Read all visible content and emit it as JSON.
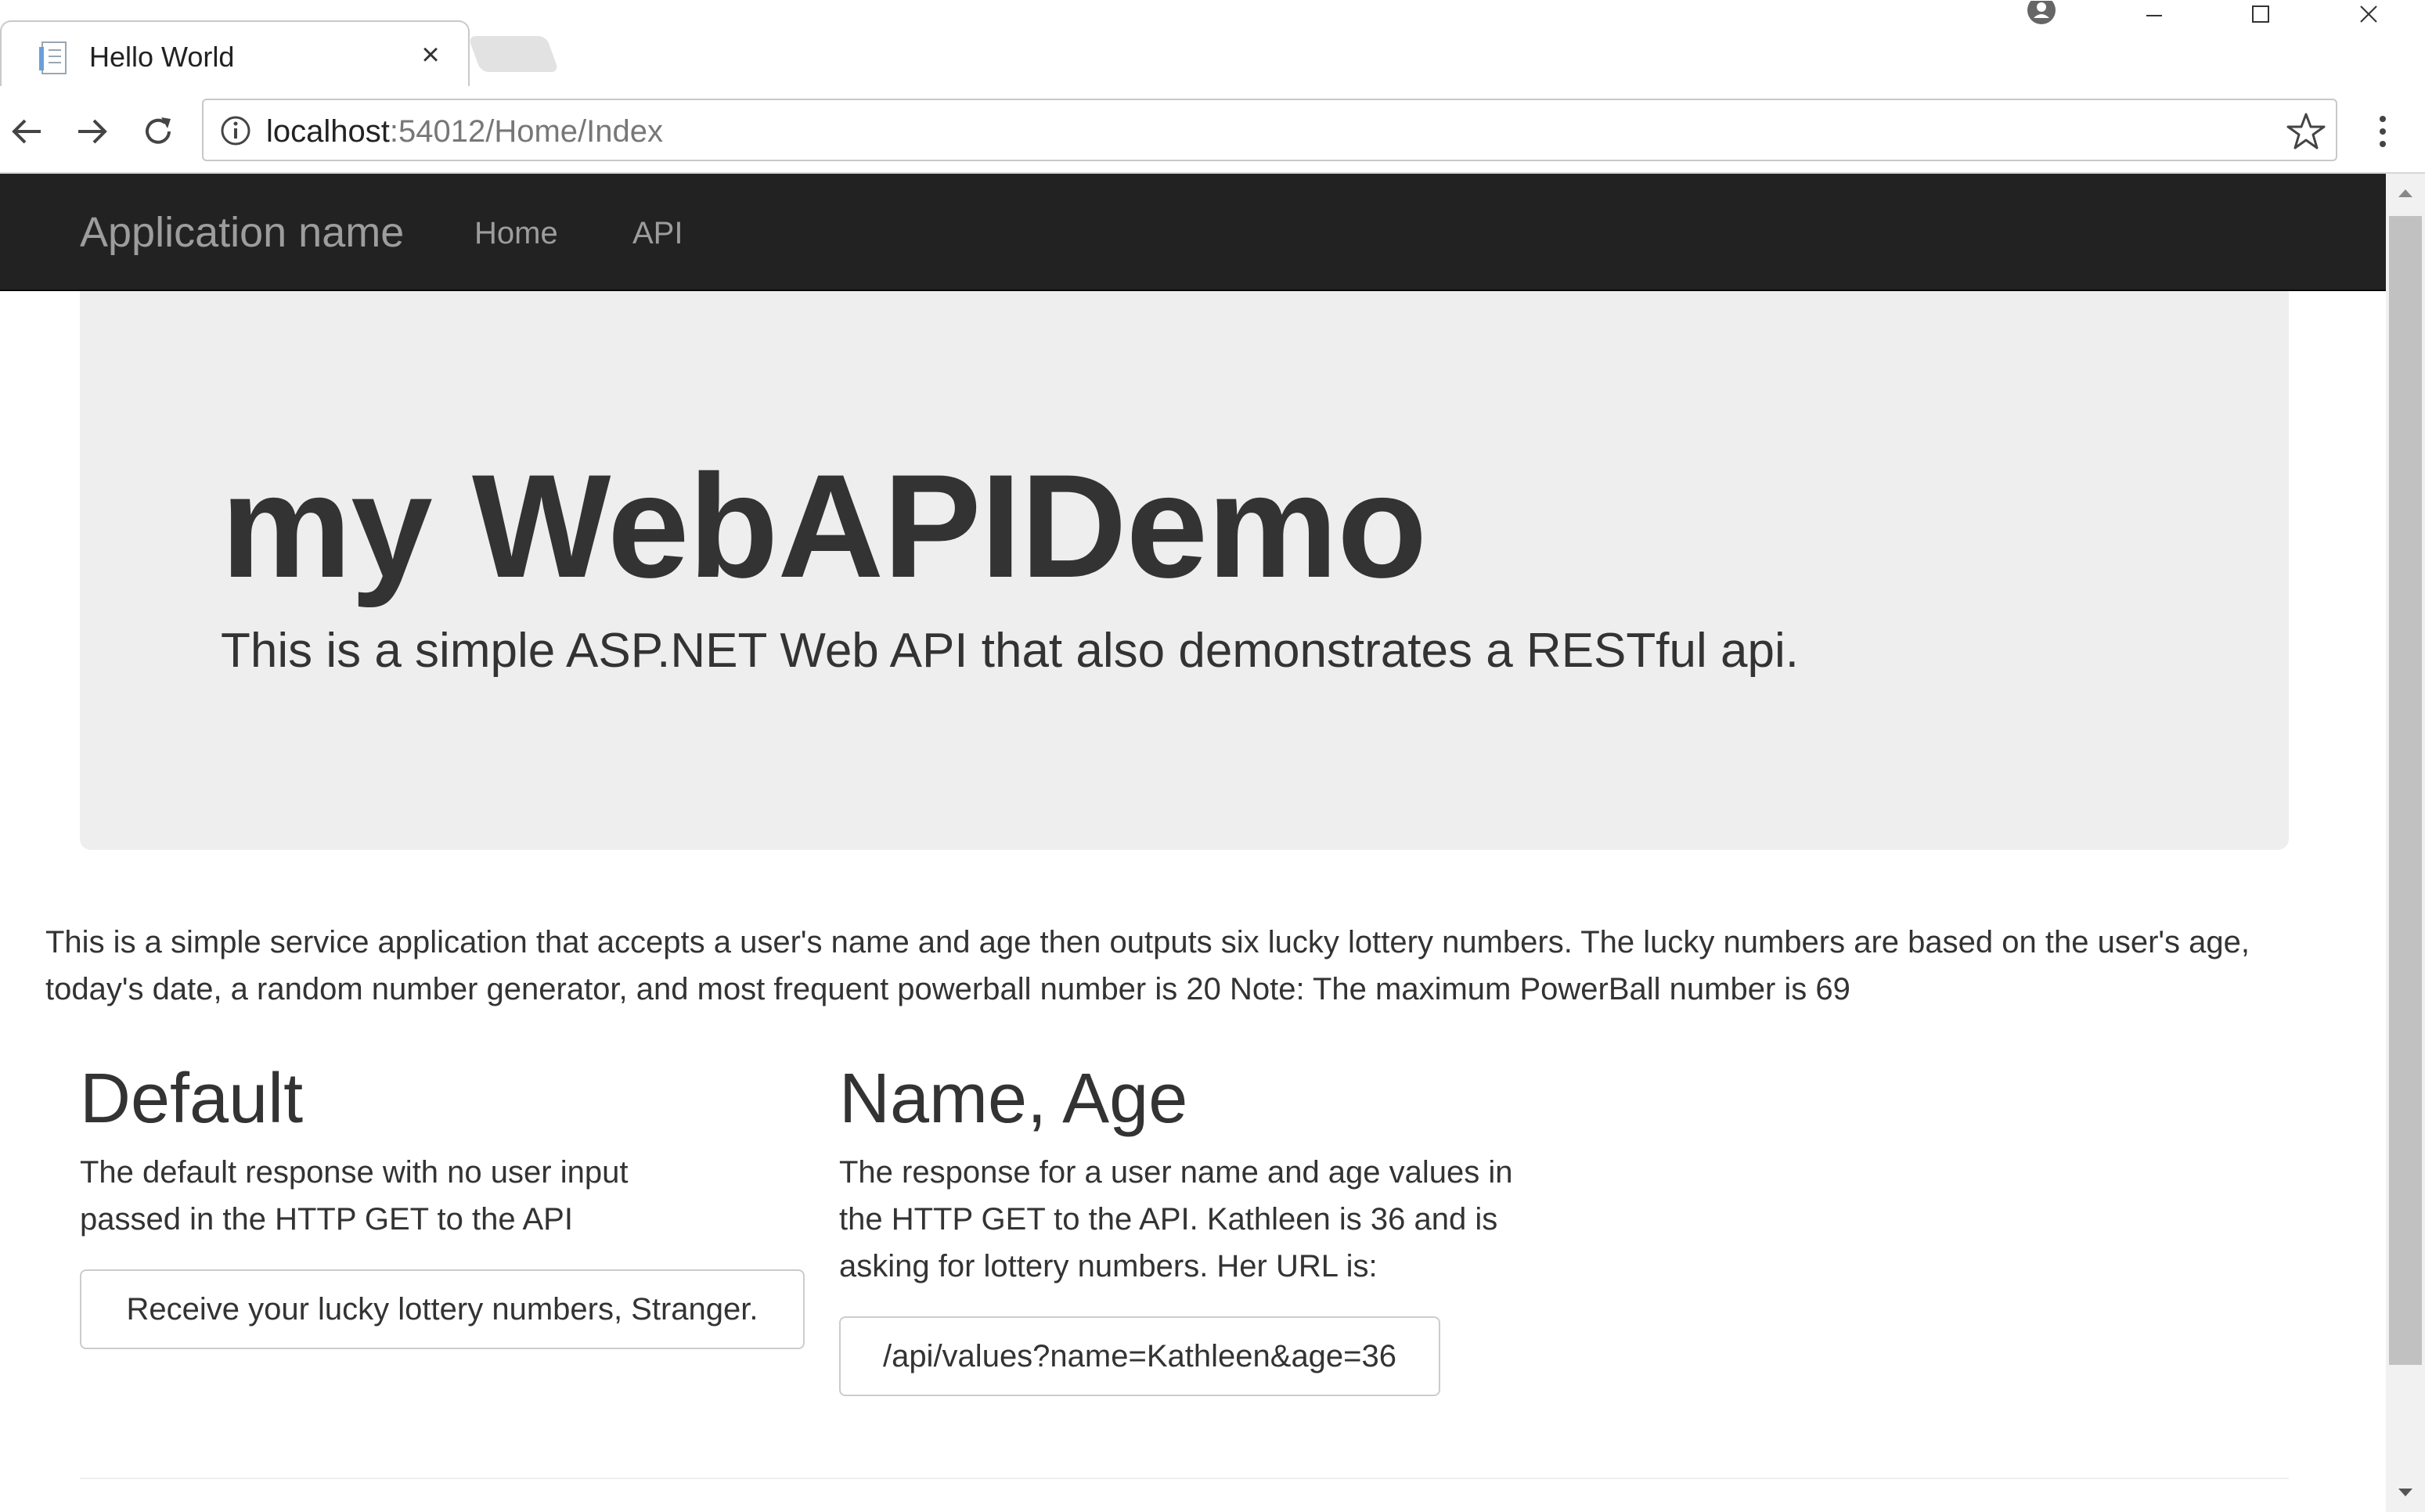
{
  "browser": {
    "tab_title": "Hello World",
    "tab_close": "×",
    "url_host": "localhost",
    "url_rest": ":54012/Home/Index",
    "icons": [
      "page-favicon-icon",
      "close-icon",
      "account-icon",
      "minimize-icon",
      "maximize-icon",
      "window-close-icon",
      "back-arrow-icon",
      "forward-arrow-icon",
      "reload-icon",
      "info-icon",
      "star-icon",
      "kebab-menu-icon"
    ]
  },
  "navbar": {
    "brand": "Application name",
    "links": [
      "Home",
      "API"
    ]
  },
  "jumbotron": {
    "title": "my WebAPIDemo",
    "lead": "This is a simple ASP.NET Web API that also demonstrates a RESTful api."
  },
  "intro": "This is a simple service application that accepts a user's name and age then outputs six lucky lottery numbers. The lucky numbers are based on the user's age, today's date, a random number generator, and most frequent powerball number is 20 Note: The maximum PowerBall number is 69",
  "sections": {
    "default": {
      "heading": "Default",
      "description": "The default response with no user input passed in the HTTP GET to the API",
      "button": "Receive your lucky lottery numbers, Stranger."
    },
    "name_age": {
      "heading": "Name, Age",
      "description": "The response for a user name and age values in the HTTP GET to the API. Kathleen is 36 and is asking for lottery numbers. Her URL is:",
      "button": "/api/values?name=Kathleen&age=36"
    }
  },
  "colors": {
    "navbar_bg": "#222222",
    "navbar_text": "#9d9d9d",
    "jumbotron_bg": "#eeeeee",
    "text": "#333333"
  }
}
